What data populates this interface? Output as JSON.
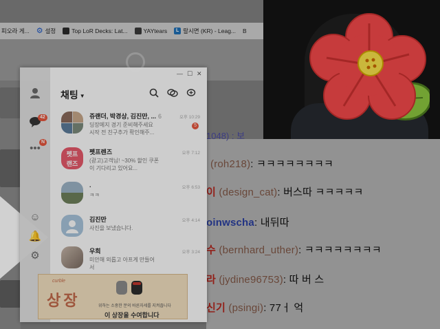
{
  "bookmarks": [
    {
      "label": "피오라 게...",
      "icon": "page-icon"
    },
    {
      "label": "설정",
      "icon": "gear-icon"
    },
    {
      "label": "Top LoR Decks: Lat...",
      "icon": "lor-icon"
    },
    {
      "label": "YAYtears",
      "icon": "yay-icon"
    },
    {
      "label": "랄시면 (KR) - Leag...",
      "icon": "l-icon"
    },
    {
      "label": "B",
      "icon": ""
    }
  ],
  "kakao": {
    "title": "채팅",
    "sidebar": {
      "chat_badge": "42",
      "more_badge": "N"
    },
    "window_controls": {
      "minimize": "—",
      "maximize": "☐",
      "close": "✕"
    },
    "chats": [
      {
        "name": "쥬랜더, 박경상, 김진만, ...",
        "count": "6",
        "message": "딩장메지 경기 준비해주세요\n시작 전 친구추가 확인해주...",
        "time": "오후 10:29",
        "unread": "5"
      },
      {
        "name": "펫프렌즈",
        "count": "",
        "message": "(광고)고객님! ~30% 할인 쿠폰\n이 기다리고 있어요...",
        "time": "오후 7:12",
        "unread": ""
      },
      {
        "name": ".",
        "count": "",
        "message": "ㅋㅋ",
        "time": "오후 6:53",
        "unread": ""
      },
      {
        "name": "김진만",
        "count": "",
        "message": "사진을 보냈습니다.",
        "time": "오후 4:14",
        "unread": ""
      },
      {
        "name": "우희",
        "count": "",
        "message": "미안해 외롭고 아프게 만들어\n서",
        "time": "오후 3:24",
        "unread": ""
      }
    ],
    "ad": {
      "brand": "curble",
      "big_text": "상장",
      "desc": "위하는 소중한 분의 바른자세를 지켜줍니다",
      "cta": "이 상장을 수여합니다"
    }
  },
  "stream_chat": {
    "top_faint": "1048) : 보",
    "lines": [
      {
        "nick": "",
        "id": "(roh218)",
        "msg": ": ㅋㅋㅋㅋㅋㅋㅋㅋ",
        "nick_color": "red"
      },
      {
        "nick": "이",
        "id": "(design_cat)",
        "msg": ": 버스따 ㅋㅋㅋㅋㅋ",
        "nick_color": "red"
      },
      {
        "nick": "oinwscha",
        "id": "",
        "msg": ": 내뒤따",
        "nick_color": "blue"
      },
      {
        "nick": "수",
        "id": "(bernhard_uther)",
        "msg": ": ㅋㅋㅋㅋㅋㅋㅋㅋ",
        "nick_color": "red"
      },
      {
        "nick": "라",
        "id": "(jydine96753)",
        "msg": ": 따 버 스",
        "nick_color": "red"
      },
      {
        "nick": "신기",
        "id": "(psingi)",
        "msg": ": 77ㅓ 억",
        "nick_color": "red"
      }
    ]
  }
}
